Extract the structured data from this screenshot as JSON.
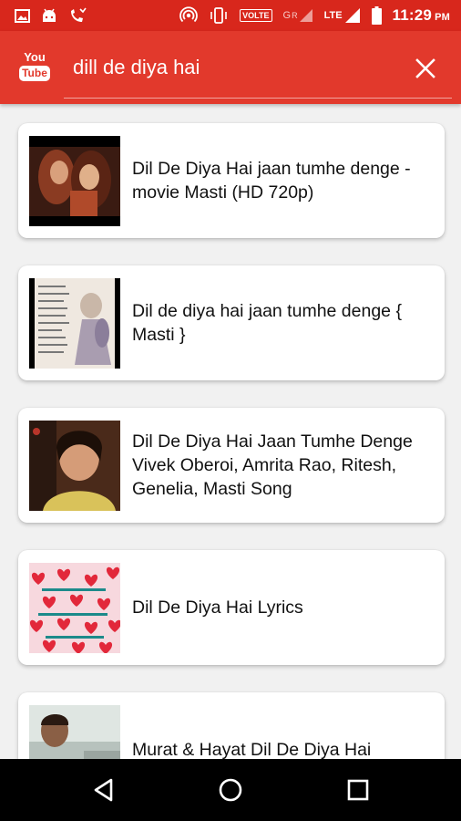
{
  "status_bar": {
    "time": "11:29",
    "ampm": "PM",
    "volte": "VOLTE",
    "lte": "LTE",
    "sim2_marker": "G",
    "roaming_marker": "R"
  },
  "app_bar": {
    "logo_top": "You",
    "logo_bottom": "Tube",
    "search_value": "dill de diya hai"
  },
  "results": [
    {
      "title": "Dil De Diya Hai jaan tumhe denge -movie Masti (HD 720p)"
    },
    {
      "title": "Dil de diya hai jaan tumhe denge { Masti }"
    },
    {
      "title": "Dil De Diya Hai Jaan Tumhe Denge   Vivek Oberoi, Amrita Rao, Ritesh, Genelia, Masti Song"
    },
    {
      "title": "Dil De Diya Hai Lyrics"
    },
    {
      "title": "Murat & Hayat Dil De Diya Hai"
    }
  ],
  "icons": {
    "status_left": [
      "image-icon",
      "android-icon",
      "missed-call-icon"
    ],
    "status_right": [
      "hotspot-icon",
      "vibrate-icon",
      "signal-icon",
      "battery-icon"
    ],
    "app_bar": [
      "youtube-logo",
      "close-icon"
    ],
    "nav": [
      "back-icon",
      "home-icon",
      "recents-icon"
    ]
  }
}
